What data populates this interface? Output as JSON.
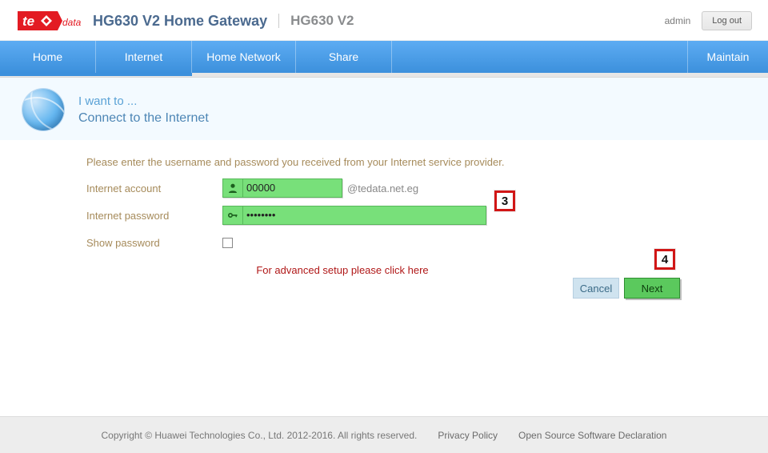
{
  "header": {
    "logo_brand": "te",
    "logo_sub": "data",
    "title_main": "HG630 V2 Home Gateway",
    "title_sub": "HG630 V2",
    "user": "admin",
    "logout": "Log out"
  },
  "nav": {
    "home": "Home",
    "internet": "Internet",
    "home_network": "Home Network",
    "share": "Share",
    "maintain": "Maintain"
  },
  "intro": {
    "line1": "I want to ...",
    "line2": "Connect to the Internet"
  },
  "form": {
    "instruction": "Please enter the username and password you received from your Internet service provider.",
    "account_label": "Internet account",
    "account_value": "00000",
    "account_suffix": "@tedata.net.eg",
    "password_label": "Internet password",
    "password_value": "••••••••",
    "show_pwd_label": "Show password",
    "advanced_link": "For advanced setup please click here"
  },
  "callouts": {
    "step3": "3",
    "step4": "4"
  },
  "buttons": {
    "cancel": "Cancel",
    "next": "Next"
  },
  "footer": {
    "copyright": "Copyright © Huawei Technologies Co., Ltd. 2012-2016. All rights reserved.",
    "privacy": "Privacy Policy",
    "oss": "Open Source Software Declaration"
  }
}
